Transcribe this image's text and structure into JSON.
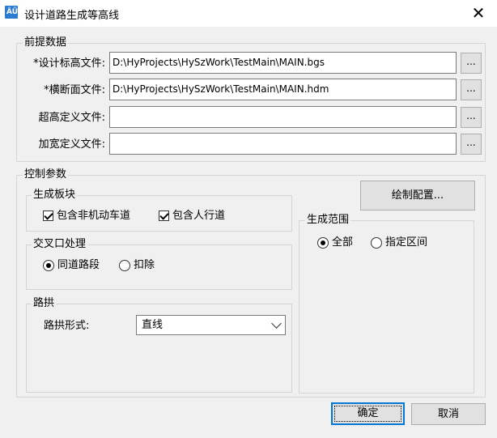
{
  "window": {
    "title": "设计道路生成等高线",
    "icon": "app-icon",
    "close": "✕"
  },
  "premise": {
    "title": "前提数据",
    "rows": [
      {
        "label": "*设计标高文件:",
        "value": "D:\\HyProjects\\HySzWork\\TestMain\\MAIN.bgs",
        "browse": "..."
      },
      {
        "label": "*横断面文件:",
        "value": "D:\\HyProjects\\HySzWork\\TestMain\\MAIN.hdm",
        "browse": "..."
      },
      {
        "label": "超高定义文件:",
        "value": "",
        "browse": "..."
      },
      {
        "label": "加宽定义文件:",
        "value": "",
        "browse": "..."
      }
    ]
  },
  "control": {
    "title": "控制参数",
    "slab": {
      "title": "生成板块",
      "options": [
        {
          "label": "包含非机动车道",
          "checked": true
        },
        {
          "label": "包含人行道",
          "checked": true
        }
      ]
    },
    "intersection": {
      "title": "交叉口处理",
      "options": [
        {
          "label": "同道路段",
          "selected": true
        },
        {
          "label": "扣除",
          "selected": false
        }
      ]
    },
    "crown": {
      "title": "路拱",
      "form_label": "路拱形式:",
      "form_value": "直线"
    },
    "draw_config_button": "绘制配置...",
    "range": {
      "title": "生成范围",
      "options": [
        {
          "label": "全部",
          "selected": true
        },
        {
          "label": "指定区间",
          "selected": false
        }
      ]
    }
  },
  "buttons": {
    "ok": "确定",
    "cancel": "取消"
  }
}
